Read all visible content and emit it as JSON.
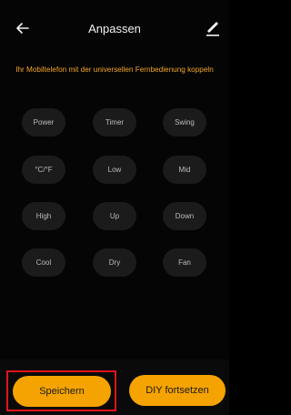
{
  "header": {
    "title": "Anpassen",
    "back_icon": "arrow-left-icon",
    "edit_icon": "pencil-icon"
  },
  "instruction": "Ihr Mobiltelefon mit der universellen Fernbedienung koppeln",
  "keys": [
    [
      "Power",
      "Timer",
      "Swing"
    ],
    [
      "°C/°F",
      "Low",
      "Mid"
    ],
    [
      "High",
      "Up",
      "Down"
    ],
    [
      "Cool",
      "Dry",
      "Fan"
    ]
  ],
  "footer": {
    "save_label": "Speichern",
    "diy_label": "DIY fortsetzen"
  },
  "colors": {
    "accent": "#f5a300",
    "instruction": "#f5a623",
    "highlight": "#e1131b",
    "key_bg": "#1b1b1b"
  }
}
